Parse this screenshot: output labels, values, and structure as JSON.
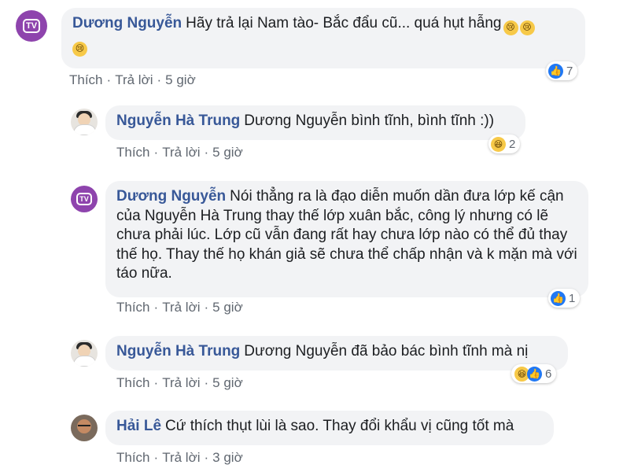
{
  "comments": [
    {
      "author": "Dương Nguyễn",
      "text": "Hãy trả lại Nam tào- Bắc đẩu cũ... quá hụt hẫng",
      "like": "Thích",
      "reply": "Trả lời",
      "time": "5 giờ",
      "reaction_count": "7",
      "avatar_text": "TV",
      "reactions": [
        "like-icon"
      ]
    },
    {
      "author": "Nguyễn Hà Trung",
      "text": "Dương Nguyễn bình tĩnh, bình tĩnh :))",
      "like": "Thích",
      "reply": "Trả lời",
      "time": "5 giờ",
      "reaction_count": "2",
      "reactions": [
        "haha-icon"
      ]
    },
    {
      "author": "Dương Nguyễn",
      "text": "Nói thẳng ra là đạo diễn muốn dần đưa lớp kế cận của Nguyễn Hà Trung thay thế lớp xuân bắc, công lý nhưng có lẽ chưa phải lúc. Lớp cũ vẫn đang rất hay chưa lớp nào có thể đủ thay thế họ. Thay thế họ khán giả sẽ chưa thể chấp nhận và k mặn mà với táo nữa.",
      "like": "Thích",
      "reply": "Trả lời",
      "time": "5 giờ",
      "reaction_count": "1",
      "avatar_text": "TV",
      "reactions": [
        "like-icon"
      ]
    },
    {
      "author": "Nguyễn Hà Trung",
      "text": "Dương Nguyễn đã bảo bác bình tĩnh mà nị",
      "like": "Thích",
      "reply": "Trả lời",
      "time": "5 giờ",
      "reaction_count": "6",
      "reactions": [
        "haha-icon",
        "like-icon"
      ]
    },
    {
      "author": "Hải Lê",
      "text": "Cứ thích thụt lùi là sao. Thay đổi khẩu vị cũng tốt mà",
      "like": "Thích",
      "reply": "Trả lời",
      "time": "3 giờ"
    }
  ],
  "separator": "·",
  "colors": {
    "name": "#385898",
    "bubble": "#f2f3f5",
    "meta": "#606770",
    "like": "#2078f4",
    "avatar_tv": "#8e44ad"
  }
}
